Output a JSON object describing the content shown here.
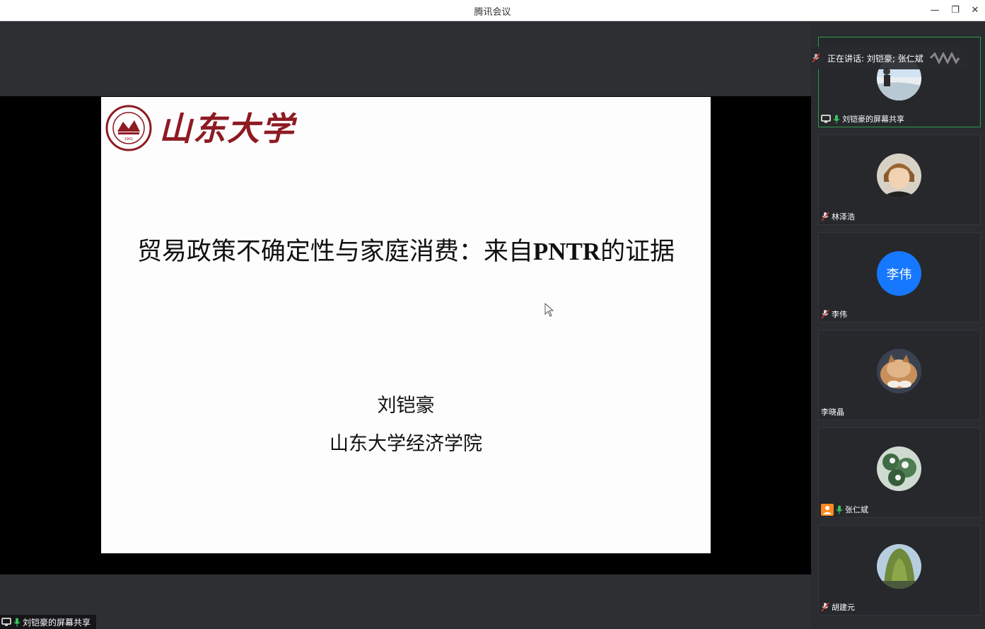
{
  "window": {
    "title": "腾讯会议",
    "minimize": "—",
    "restore": "❐",
    "close": "✕"
  },
  "slide": {
    "logo_text": "山东大学",
    "logo_seal_text": "SHANDONG UNIVERSITY",
    "logo_seal_year": "1901",
    "title_part1": "贸易政策不确定性与家庭消费：来自",
    "title_latin": "PNTR",
    "title_part2": "的证据",
    "author": "刘铠豪",
    "institution": "山东大学经济学院"
  },
  "share_tag": {
    "label": "刘铠豪的屏幕共享"
  },
  "speaking_banner": {
    "label": "正在讲话: 刘铠豪; 张仁斌"
  },
  "participants": [
    {
      "name": "刘铠豪的屏幕共享",
      "mic": "on",
      "sharing": true,
      "avatar": "photo-beach",
      "active": true
    },
    {
      "name": "林泽浩",
      "mic": "muted",
      "avatar": "photo-anime"
    },
    {
      "name": "李伟",
      "mic": "muted",
      "avatar": "initials",
      "initials": "李伟",
      "avatar_color": "#1677ff"
    },
    {
      "name": "李晓晶",
      "mic": "none",
      "avatar": "photo-cat"
    },
    {
      "name": "张仁斌",
      "mic": "on",
      "host": true,
      "avatar": "photo-flowers"
    },
    {
      "name": "胡建元",
      "mic": "muted",
      "avatar": "photo-willow"
    }
  ],
  "colors": {
    "accent_green": "#2a9d4a",
    "mic_green": "#39c45a",
    "muted_red": "#e53935",
    "host_orange": "#ff8a1f",
    "logo_red": "#8e1a22"
  }
}
